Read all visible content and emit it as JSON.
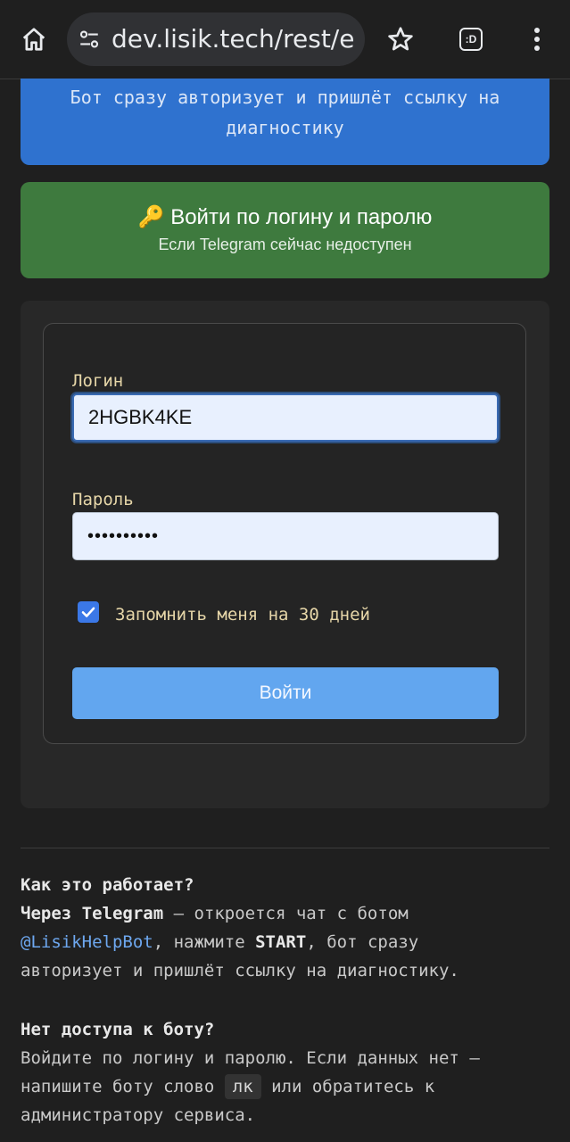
{
  "browser": {
    "url": "dev.lisik.tech/rest/e",
    "tabs_icon_label": ":D"
  },
  "blue_card": {
    "line1": "Бот сразу авторизует и пришлёт ссылку на",
    "line2": "диагностику"
  },
  "login_option": {
    "emoji": "🔑",
    "title": "Войти по логину и паролю",
    "subtitle": "Если Telegram сейчас недоступен"
  },
  "form": {
    "login_label": "Логин",
    "login_value": "2HGBK4KE",
    "password_label": "Пароль",
    "password_value": "••••••••••",
    "remember_label": "Запомнить меня на 30 дней",
    "remember_checked": true,
    "submit_label": "Войти"
  },
  "help": {
    "q1_title": "Как это работает?",
    "q1_line1_bold": "Через Telegram",
    "q1_line1_rest": " — откроется чат с ботом",
    "q1_bot": "@LisikHelpBot",
    "q1_line2_mid": ", нажмите ",
    "q1_start": "START",
    "q1_line2_end": ", бот сразу",
    "q1_line3": "авторизует и пришлёт ссылку на диагностику.",
    "q2_title": "Нет доступа к боту?",
    "q2_line1": "Войдите по логину и паролю. Если данных нет —",
    "q2_line2_pre": "напишите боту слово ",
    "q2_code": "лк",
    "q2_line2_post": " или обратитесь к",
    "q2_line3": "администратору сервиса."
  },
  "colors": {
    "background": "#1f1f1f",
    "blue_card": "#2f72cf",
    "green_card": "#3e7a3e",
    "submit": "#62a6ef",
    "label": "#e6d6a8",
    "link": "#6ea8f0"
  }
}
